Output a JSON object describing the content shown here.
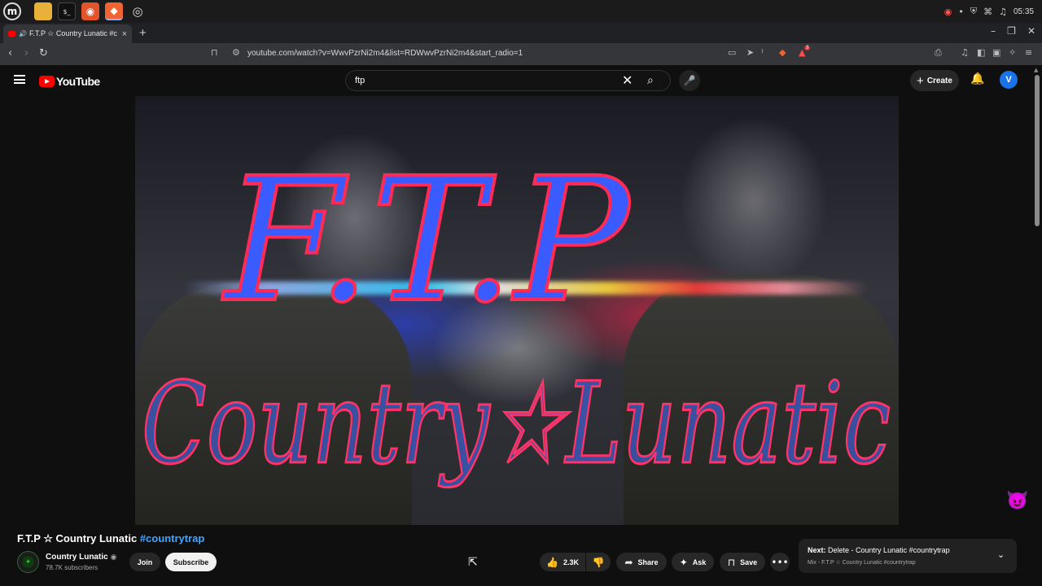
{
  "taskbar": {
    "apps": [
      {
        "icon": "linux-mint-menu-icon",
        "glyph": "m"
      },
      {
        "icon": "files-icon",
        "glyph": "▬"
      },
      {
        "icon": "terminal-icon",
        "glyph": "$_"
      },
      {
        "icon": "firefox-icon",
        "glyph": "◉"
      },
      {
        "icon": "brave-icon",
        "glyph": "◆"
      },
      {
        "icon": "obs-icon",
        "glyph": "◎"
      }
    ],
    "clock": "05:35",
    "tray_icons": [
      "obs-tray-icon",
      "shield-icon",
      "network-icon",
      "music-icon"
    ]
  },
  "browser": {
    "tab_title": "F.T.P ☆ Country Lunatic #c",
    "new_tab": "+",
    "url": "youtube.com/watch?v=WwvPzrNi2m4&list=RDWwvPzrNi2m4&start_radio=1",
    "shield_badge": "3"
  },
  "youtube": {
    "logo_text": "YouTube",
    "search_query": "ftp",
    "create_label": "Create",
    "avatar_letter": "V"
  },
  "video": {
    "art_text_top": "F.T.P",
    "art_text_bottom": "Country☆Lunatic"
  },
  "watch": {
    "title": "F.T.P ☆ Country Lunatic",
    "hashtag": "#countrytrap",
    "channel": "Country Lunatic",
    "subscribers": "78.7K subscribers",
    "join_label": "Join",
    "subscribe_label": "Subscribe",
    "likes": "2.3K",
    "share_label": "Share",
    "ask_label": "Ask",
    "save_label": "Save",
    "next_prefix": "Next:",
    "next_title": "Delete - Country Lunatic #countrytrap",
    "next_mix": "Mix - F.T.P ☆ Country Lunatic #countrytrap"
  },
  "colors": {
    "accent_red": "#ff0000",
    "link_blue": "#3ea6ff",
    "avatar_blue": "#1a73e8"
  }
}
